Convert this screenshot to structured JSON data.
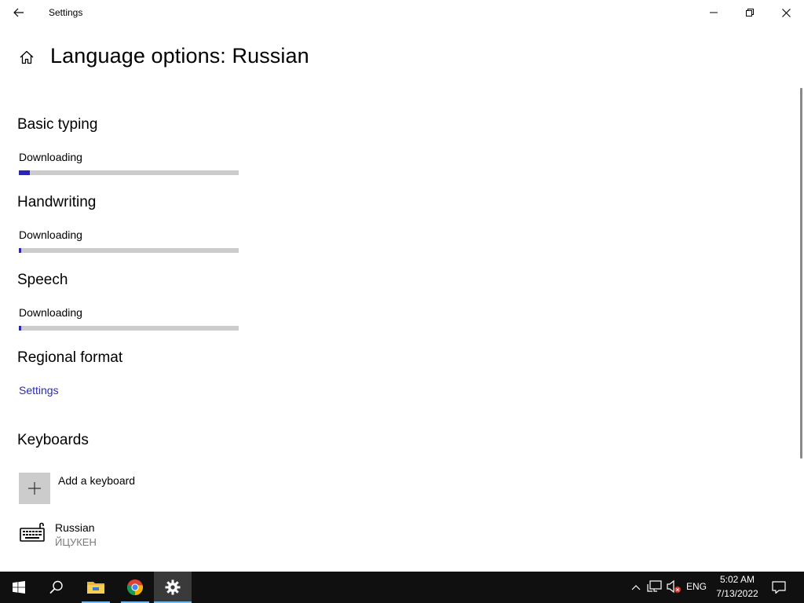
{
  "window": {
    "title": "Settings"
  },
  "page": {
    "title": "Language options: Russian"
  },
  "sections": {
    "basic_typing": {
      "title": "Basic typing",
      "status": "Downloading",
      "progress": 0.05
    },
    "handwriting": {
      "title": "Handwriting",
      "status": "Downloading",
      "progress": 0.01
    },
    "speech": {
      "title": "Speech",
      "status": "Downloading",
      "progress": 0.01
    },
    "regional_format": {
      "title": "Regional format",
      "link": "Settings"
    },
    "keyboards": {
      "title": "Keyboards",
      "add_label": "Add a keyboard",
      "items": [
        {
          "name": "Russian",
          "layout": "ЙЦУКЕН"
        }
      ]
    }
  },
  "taskbar": {
    "apps": [
      "start-icon",
      "search-icon",
      "file-explorer-icon",
      "chrome-icon",
      "settings-icon"
    ],
    "language": "ENG",
    "time": "5:02 AM",
    "date": "7/13/2022"
  },
  "colors": {
    "accent": "#2b27b0",
    "link": "#2b2bb5",
    "progress_track": "#cccccc",
    "taskbar": "#101010"
  }
}
